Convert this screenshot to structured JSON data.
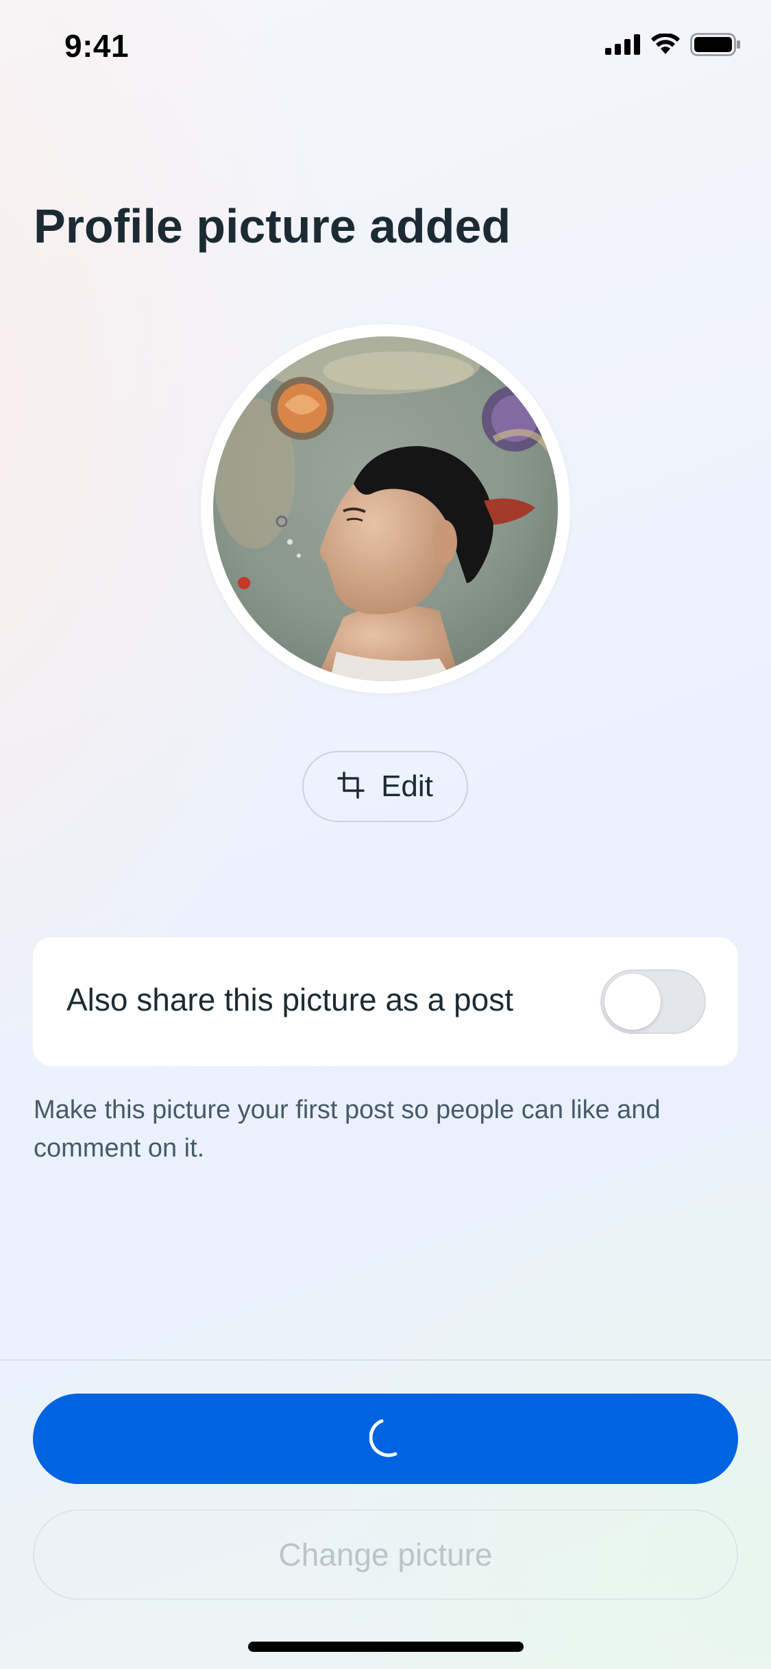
{
  "status_bar": {
    "time": "9:41",
    "icons": [
      "cellular-signal-icon",
      "wifi-icon",
      "battery-icon"
    ]
  },
  "page": {
    "title": "Profile picture added"
  },
  "avatar": {
    "description_icon": "profile-photo"
  },
  "edit_button": {
    "icon": "crop-icon",
    "label": "Edit"
  },
  "share_card": {
    "label": "Also share this picture as a post",
    "toggle_on": false
  },
  "helper_text": "Make this picture your first post so people can like and comment on it.",
  "primary_button": {
    "state": "loading",
    "icon": "loading-spinner-icon"
  },
  "secondary_button": {
    "label": "Change picture",
    "state": "disabled"
  },
  "colors": {
    "primary": "#0064e0",
    "text": "#1c2b33",
    "secondary_text": "#465a69",
    "disabled_text": "#bcc3c9"
  }
}
